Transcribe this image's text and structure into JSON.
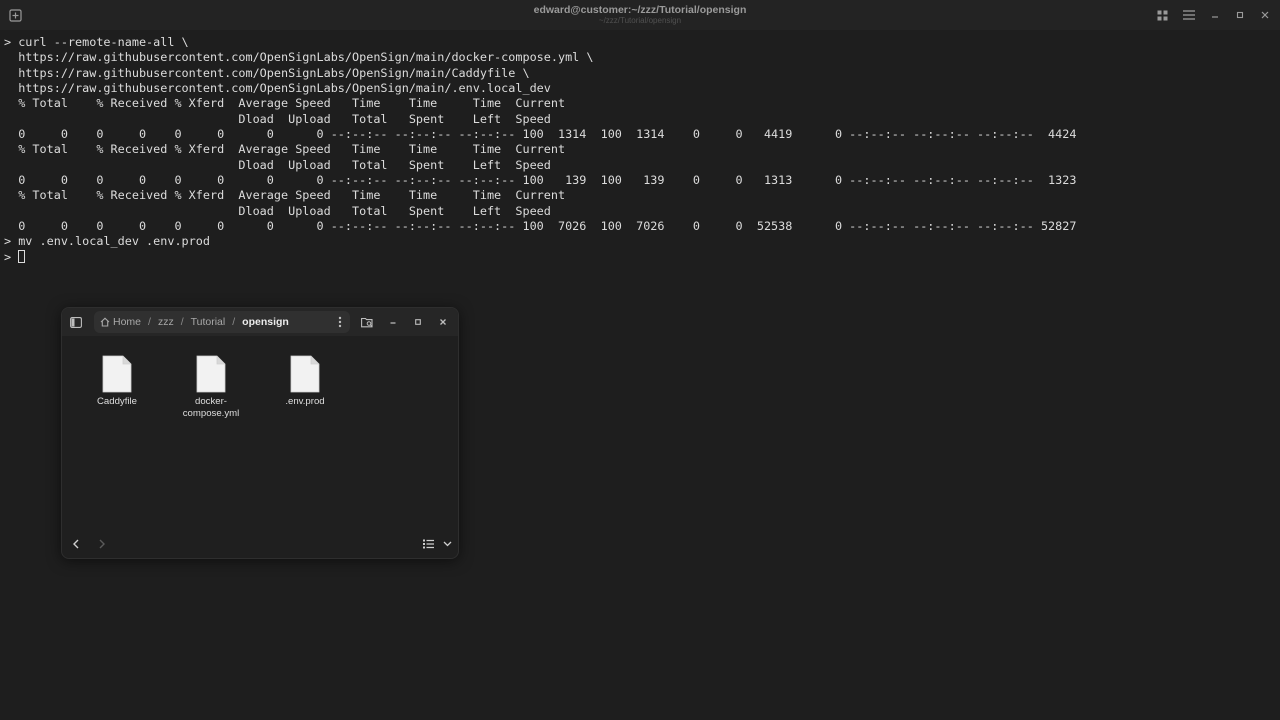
{
  "terminal": {
    "title": "edward@customer:~/zzz/Tutorial/opensign",
    "subtitle": "~/zzz/Tutorial/opensign",
    "lines": [
      "> curl --remote-name-all \\",
      "  https://raw.githubusercontent.com/OpenSignLabs/OpenSign/main/docker-compose.yml \\",
      "  https://raw.githubusercontent.com/OpenSignLabs/OpenSign/main/Caddyfile \\",
      "  https://raw.githubusercontent.com/OpenSignLabs/OpenSign/main/.env.local_dev",
      "  % Total    % Received % Xferd  Average Speed   Time    Time     Time  Current",
      "                                 Dload  Upload   Total   Spent    Left  Speed",
      "  0     0    0     0    0     0      0      0 --:--:-- --:--:-- --:--:-- 100  1314  100  1314    0     0   4419      0 --:--:-- --:--:-- --:--:--  4424",
      "  % Total    % Received % Xferd  Average Speed   Time    Time     Time  Current",
      "                                 Dload  Upload   Total   Spent    Left  Speed",
      "  0     0    0     0    0     0      0      0 --:--:-- --:--:-- --:--:-- 100   139  100   139    0     0   1313      0 --:--:-- --:--:-- --:--:--  1323",
      "  % Total    % Received % Xferd  Average Speed   Time    Time     Time  Current",
      "                                 Dload  Upload   Total   Spent    Left  Speed",
      "  0     0    0     0    0     0      0      0 --:--:-- --:--:-- --:--:-- 100  7026  100  7026    0     0  52538      0 --:--:-- --:--:-- --:--:-- 52827",
      "> mv .env.local_dev .env.prod",
      "> "
    ]
  },
  "file_manager": {
    "breadcrumb": {
      "home": "Home",
      "separator": "/",
      "parts": [
        "zzz",
        "Tutorial"
      ],
      "current": "opensign"
    },
    "files": [
      {
        "name": "Caddyfile"
      },
      {
        "name": "docker-\ncompose.yml"
      },
      {
        "name": ".env.prod"
      }
    ]
  },
  "icons": {
    "new_tab": "new-tab-icon",
    "grid": "grid-icon",
    "menu": "hamburger-menu-icon",
    "minimize": "minimize-icon",
    "maximize": "maximize-icon",
    "close": "close-icon",
    "sidebar_toggle": "sidebar-toggle-icon",
    "kebab": "kebab-menu-icon",
    "search_folder": "search-folder-icon",
    "back": "chevron-left-icon",
    "forward": "chevron-right-icon",
    "list_view": "list-view-icon",
    "view_dropdown": "chevron-down-icon",
    "file": "document-icon"
  },
  "colors": {
    "background": "#1e1e1e",
    "terminal_text": "#dcdcdc",
    "header_text": "#9a9a9a",
    "window_bg": "#1f1f1f",
    "pathbar_bg": "#303030"
  }
}
